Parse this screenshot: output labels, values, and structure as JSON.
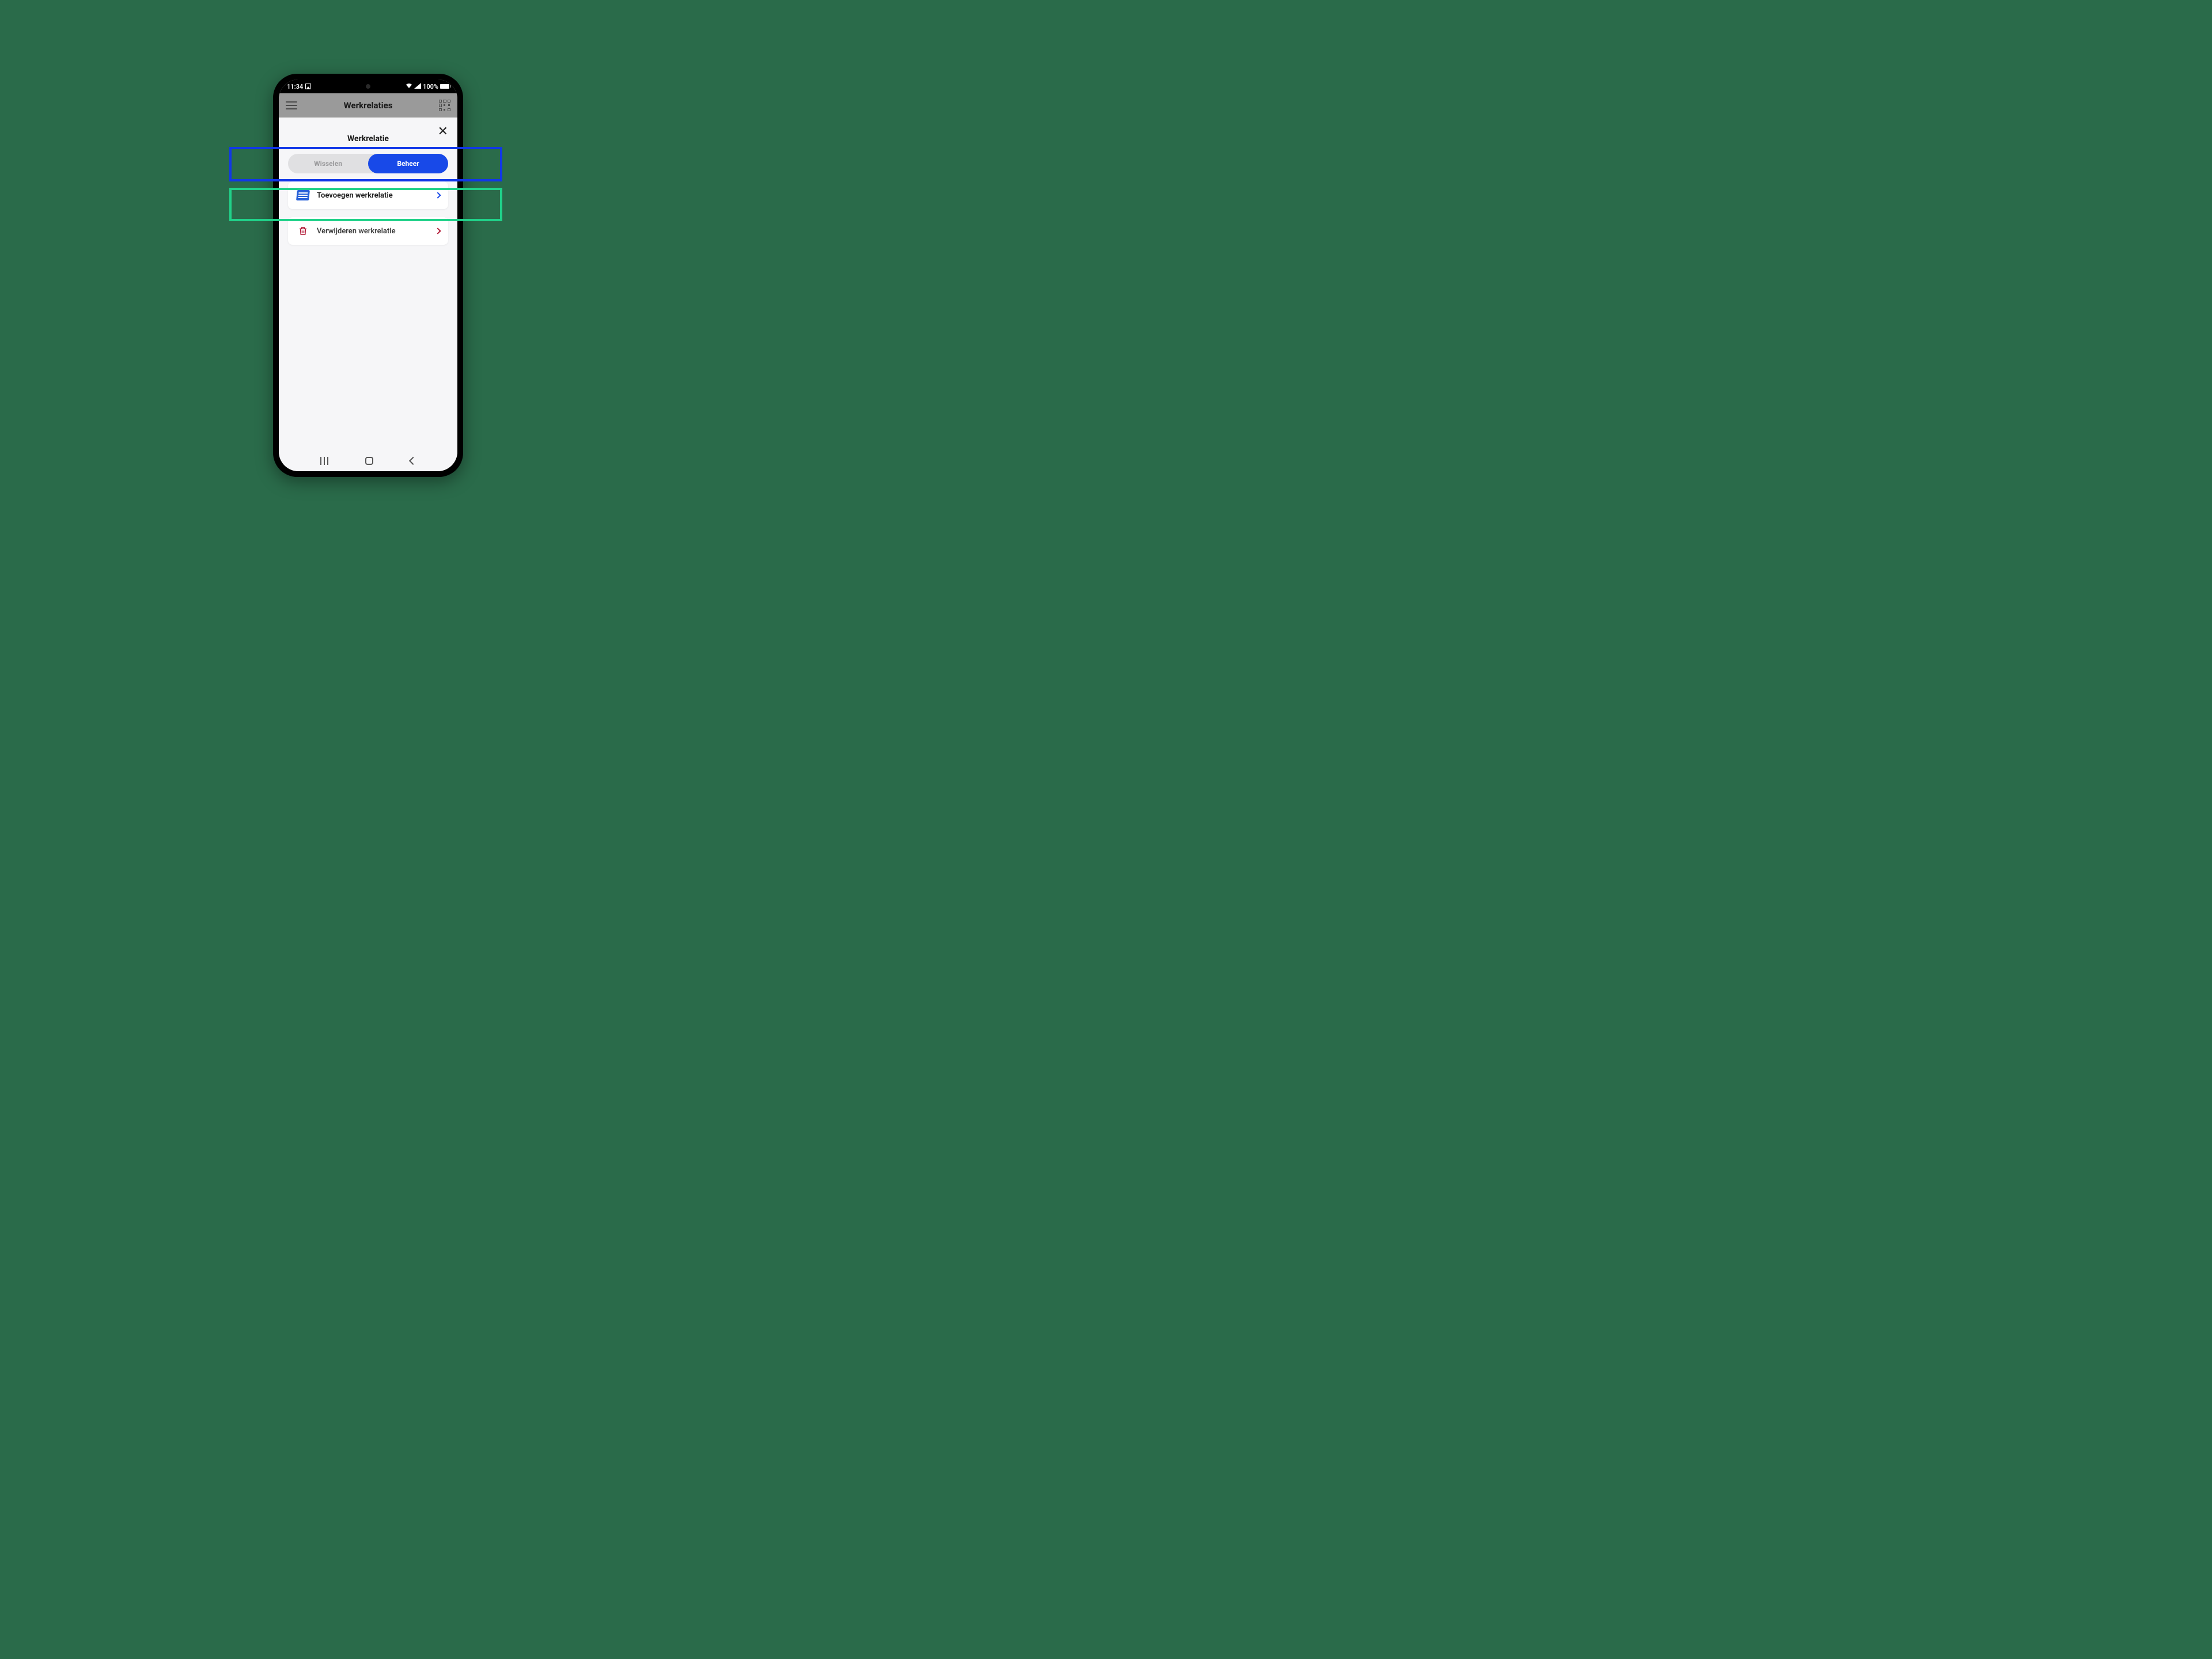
{
  "status_bar": {
    "time": "11:34",
    "battery_text": "100%"
  },
  "app_header": {
    "title": "Werkrelaties"
  },
  "sheet": {
    "title": "Werkrelatie",
    "segmented": {
      "inactive": "Wisselen",
      "active": "Beheer"
    },
    "items": [
      {
        "label": "Toevoegen werkrelatie"
      },
      {
        "label": "Verwijderen werkrelatie"
      }
    ]
  },
  "annotations": {
    "blue_color": "#1137e8",
    "green_color": "#20d189"
  }
}
